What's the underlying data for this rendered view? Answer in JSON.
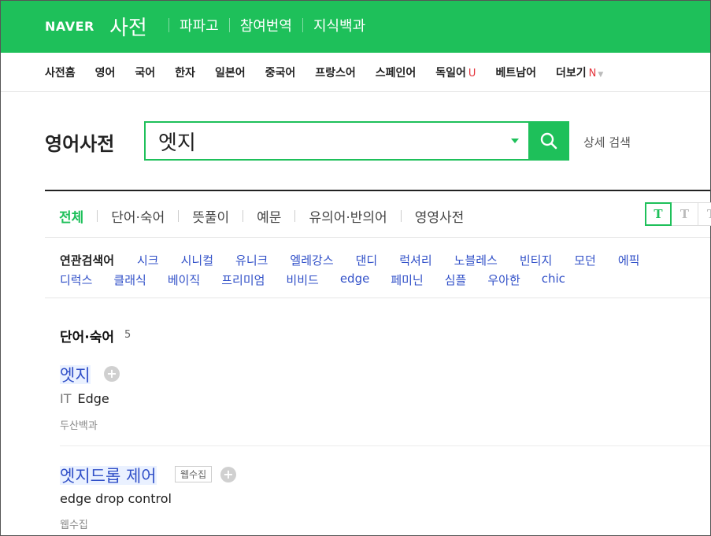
{
  "header": {
    "naver_logo": "NAVER",
    "dict_logo": "사전",
    "links": [
      "파파고",
      "참여번역",
      "지식백과"
    ]
  },
  "lang_nav": {
    "items": [
      {
        "label": "사전홈",
        "badge": ""
      },
      {
        "label": "영어",
        "badge": ""
      },
      {
        "label": "국어",
        "badge": ""
      },
      {
        "label": "한자",
        "badge": ""
      },
      {
        "label": "일본어",
        "badge": ""
      },
      {
        "label": "중국어",
        "badge": ""
      },
      {
        "label": "프랑스어",
        "badge": ""
      },
      {
        "label": "스페인어",
        "badge": ""
      },
      {
        "label": "독일어",
        "badge": "U"
      },
      {
        "label": "베트남어",
        "badge": ""
      },
      {
        "label": "더보기",
        "badge": "N"
      }
    ]
  },
  "search": {
    "title": "영어사전",
    "value": "엣지",
    "detail_search": "상세 검색"
  },
  "tabs": [
    "전체",
    "단어·숙어",
    "뜻풀이",
    "예문",
    "유의어·반의어",
    "영영사전"
  ],
  "font_size_buttons": [
    "T",
    "T",
    "T"
  ],
  "related": {
    "label": "연관검색어",
    "row1": [
      "시크",
      "시니컬",
      "유니크",
      "엘레강스",
      "댄디",
      "럭셔리",
      "노블레스",
      "빈티지",
      "모던",
      "에픽"
    ],
    "row2": [
      "디럭스",
      "클래식",
      "베이직",
      "프리미엄",
      "비비드",
      "edge",
      "페미닌",
      "심플",
      "우아한",
      "chic"
    ]
  },
  "section": {
    "title": "단어·숙어",
    "count": "5"
  },
  "entries": [
    {
      "word": "엣지",
      "tag": "",
      "field": "IT",
      "meaning": "Edge",
      "source": "두산백과"
    },
    {
      "word": "엣지드롭 제어",
      "tag": "웹수집",
      "field": "",
      "meaning": "edge drop control",
      "source": "웹수집"
    }
  ],
  "colors": {
    "brand": "#1ec05a",
    "link": "#3150c8",
    "badge": "#e4343c"
  }
}
